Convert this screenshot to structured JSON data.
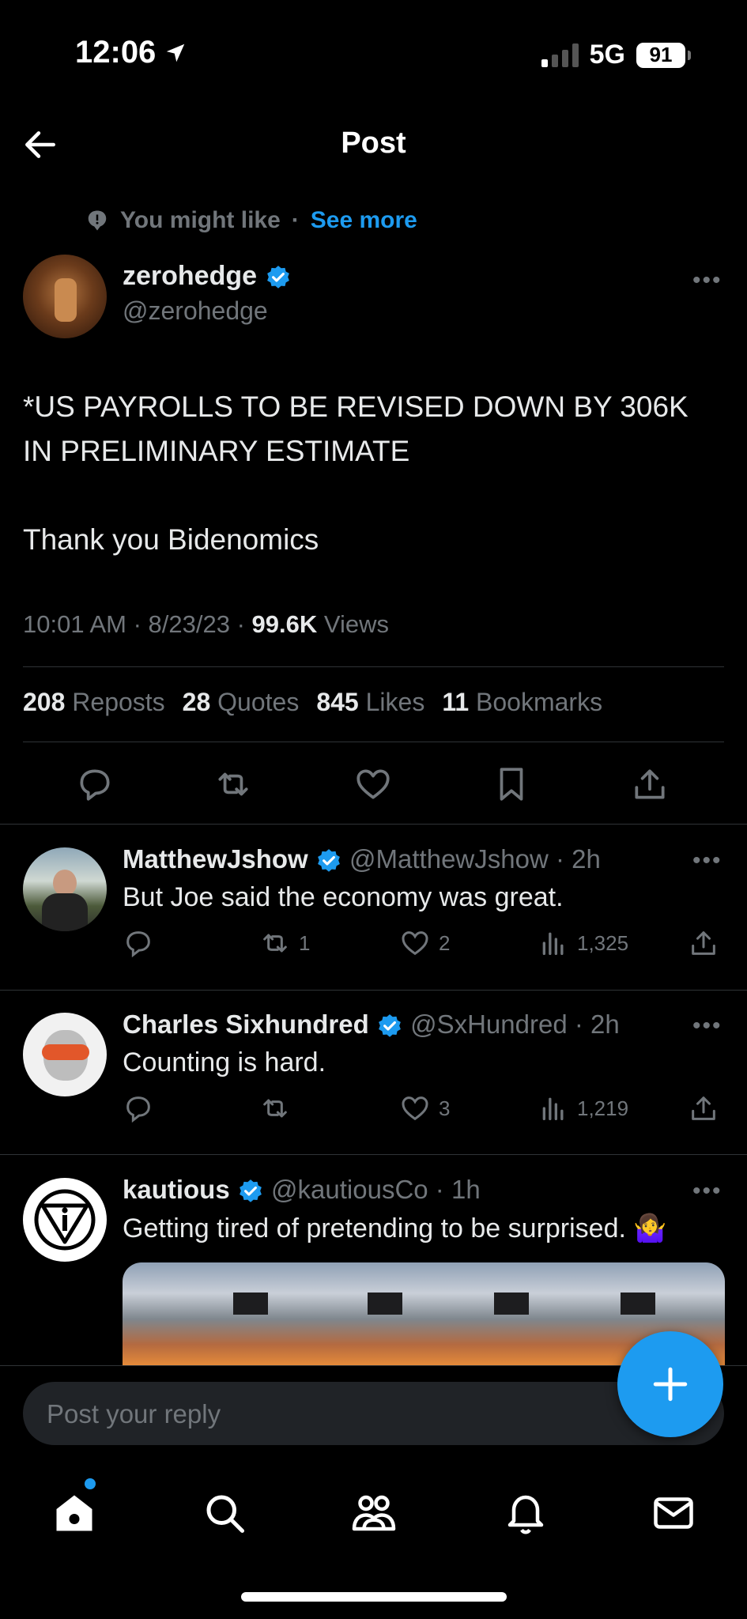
{
  "status_bar": {
    "time": "12:06",
    "network": "5G",
    "battery": "91"
  },
  "nav": {
    "title": "Post"
  },
  "context": {
    "label": "You might like",
    "separator": "·",
    "link": "See more"
  },
  "main_post": {
    "author_name": "zerohedge",
    "author_handle": "@zerohedge",
    "text": "*US PAYROLLS TO BE REVISED DOWN BY 306K\nIN PRELIMINARY ESTIMATE\n\nThank you Bidenomics",
    "time": "10:01 AM · 8/23/23 · ",
    "views_count": "99.6K",
    "views_label": " Views",
    "stats": {
      "reposts_count": "208",
      "reposts_label": "Reposts",
      "quotes_count": "28",
      "quotes_label": "Quotes",
      "likes_count": "845",
      "likes_label": "Likes",
      "bookmarks_count": "11",
      "bookmarks_label": "Bookmarks"
    }
  },
  "replies": [
    {
      "name": "MatthewJshow",
      "handle": "@MatthewJshow · 2h",
      "text": "But Joe said the economy was great.",
      "reposts": "1",
      "likes": "2",
      "views": "1,325"
    },
    {
      "name": "Charles Sixhundred",
      "handle": "@SxHundred · 2h",
      "text": "Counting is hard.",
      "reposts": "",
      "likes": "3",
      "views": "1,219"
    },
    {
      "name": "kautious",
      "handle": "@kautiousCo · 1h",
      "text": "Getting tired of pretending to be surprised. 🤷‍♀️"
    }
  ],
  "reply_box": {
    "placeholder": "Post your reply"
  },
  "colors": {
    "accent": "#1d9bf0",
    "background": "#000000",
    "muted": "#71767b"
  }
}
